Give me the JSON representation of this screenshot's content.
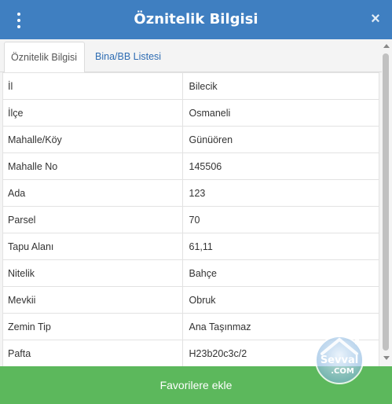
{
  "header": {
    "title": "Öznitelik Bilgisi",
    "close_label": "×"
  },
  "tabs": [
    {
      "label": "Öznitelik Bilgisi",
      "active": true
    },
    {
      "label": "Bina/BB Listesi",
      "active": false
    }
  ],
  "attributes": [
    {
      "key": "İl",
      "value": "Bilecik"
    },
    {
      "key": "İlçe",
      "value": "Osmaneli"
    },
    {
      "key": "Mahalle/Köy",
      "value": "Günüören"
    },
    {
      "key": "Mahalle No",
      "value": "145506"
    },
    {
      "key": "Ada",
      "value": "123"
    },
    {
      "key": "Parsel",
      "value": "70"
    },
    {
      "key": "Tapu Alanı",
      "value": "61,11"
    },
    {
      "key": "Nitelik",
      "value": "Bahçe"
    },
    {
      "key": "Mevkii",
      "value": "Obruk"
    },
    {
      "key": "Zemin Tip",
      "value": "Ana Taşınmaz"
    },
    {
      "key": "Pafta",
      "value": "H23b20c3c/2"
    }
  ],
  "footer": {
    "button_label": "Favorilere ekle"
  },
  "watermark": {
    "text_top": "Sevval",
    "text_bottom": ".COM"
  },
  "colors": {
    "header": "#3f7fc1",
    "footer_button": "#5cb85c",
    "active_tab_text": "#555555",
    "inactive_tab_text": "#2f6db3"
  },
  "icons": {
    "menu": "kebab-menu-icon",
    "close": "close-icon"
  }
}
